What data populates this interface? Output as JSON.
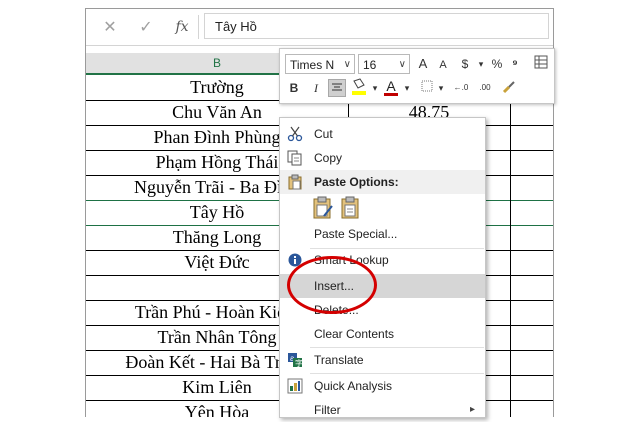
{
  "formula_bar": {
    "cancel_glyph": "✕",
    "enter_glyph": "✓",
    "fx_label": "fx",
    "value": "Tây Hồ"
  },
  "columns": {
    "b_header": "B"
  },
  "rows": [
    {
      "b": "Trường",
      "c": ""
    },
    {
      "b": "Chu Văn An",
      "c": "48.75"
    },
    {
      "b": "Phan Đình Phùng",
      "c": ""
    },
    {
      "b": "Phạm Hồng Thái",
      "c": ""
    },
    {
      "b": "Nguyễn Trãi - Ba Đình",
      "c": ""
    },
    {
      "b": "Tây Hồ",
      "c": ""
    },
    {
      "b": "Thăng Long",
      "c": ""
    },
    {
      "b": "Việt Đức",
      "c": ""
    },
    {
      "b": "",
      "c": ""
    },
    {
      "b": "Trần Phú - Hoàn Kiếm",
      "c": ""
    },
    {
      "b": "Trần Nhân Tông",
      "c": ""
    },
    {
      "b": "Đoàn Kết - Hai Bà Trưng",
      "c": ""
    },
    {
      "b": "Kim Liên",
      "c": ""
    },
    {
      "b": "Yên Hòa",
      "c": ""
    }
  ],
  "mini_toolbar": {
    "font_name": "Times N",
    "font_size": "16",
    "grow_font": "A",
    "shrink_font": "A",
    "currency": "$",
    "percent": "%",
    "comma": "⁹",
    "bold": "B",
    "italic": "I",
    "font_color_letter": "A",
    "inc_decimal": "←.0",
    "dec_decimal": ".00",
    "accent_fill": "#ffff00",
    "accent_font": "#c00000"
  },
  "context_menu": {
    "items": [
      {
        "label": "Cut",
        "icon": "scissors-icon"
      },
      {
        "label": "Copy",
        "icon": "copy-icon"
      },
      {
        "label": "Paste Options:",
        "icon": "paste-icon"
      },
      {
        "label": "Paste Special...",
        "icon": ""
      },
      {
        "label": "Smart Lookup",
        "icon": "smart-lookup-icon"
      },
      {
        "label": "Insert...",
        "icon": ""
      },
      {
        "label": "Delete...",
        "icon": ""
      },
      {
        "label": "Clear Contents",
        "icon": ""
      },
      {
        "label": "Translate",
        "icon": "translate-icon"
      },
      {
        "label": "Quick Analysis",
        "icon": "quick-analysis-icon"
      },
      {
        "label": "Filter",
        "icon": ""
      }
    ],
    "highlight_color": "#d40000"
  }
}
